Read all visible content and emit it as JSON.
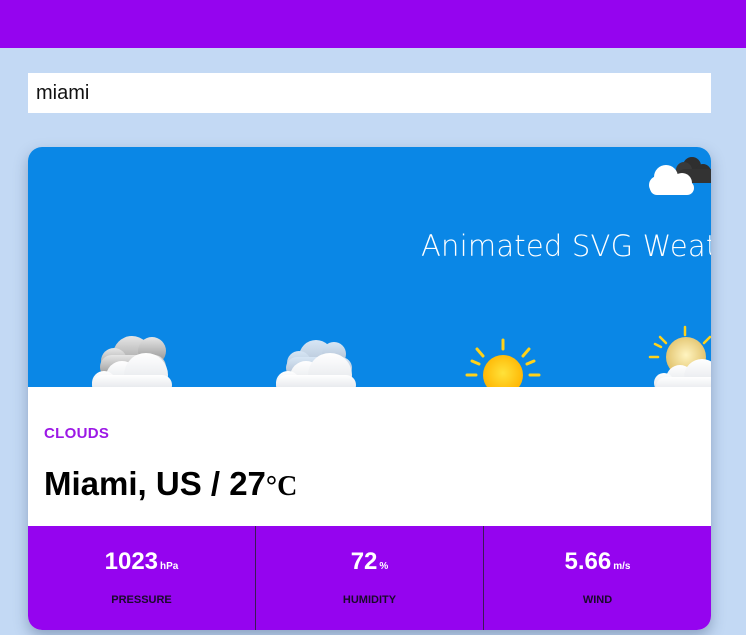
{
  "search": {
    "value": "miami"
  },
  "banner": {
    "title": "Animated SVG Weather"
  },
  "weather": {
    "condition": "CLOUDS",
    "city": "Miami, US / 27",
    "temp_unit": "°C"
  },
  "stats": [
    {
      "value": "1023",
      "unit": "hPa",
      "label": "PRESSURE"
    },
    {
      "value": "72",
      "unit": "%",
      "label": "HUMIDITY"
    },
    {
      "value": "5.66",
      "unit": "m/s",
      "label": "WIND"
    }
  ],
  "colors": {
    "accent": "#9504ef",
    "background": "#c3d9f4",
    "banner": "#0a87e6",
    "condition_text": "#9c18e6"
  },
  "icons": [
    "cloud-dark-icon",
    "storm-cloud-icon",
    "cloudy-icon",
    "sun-icon",
    "partly-sunny-icon"
  ]
}
